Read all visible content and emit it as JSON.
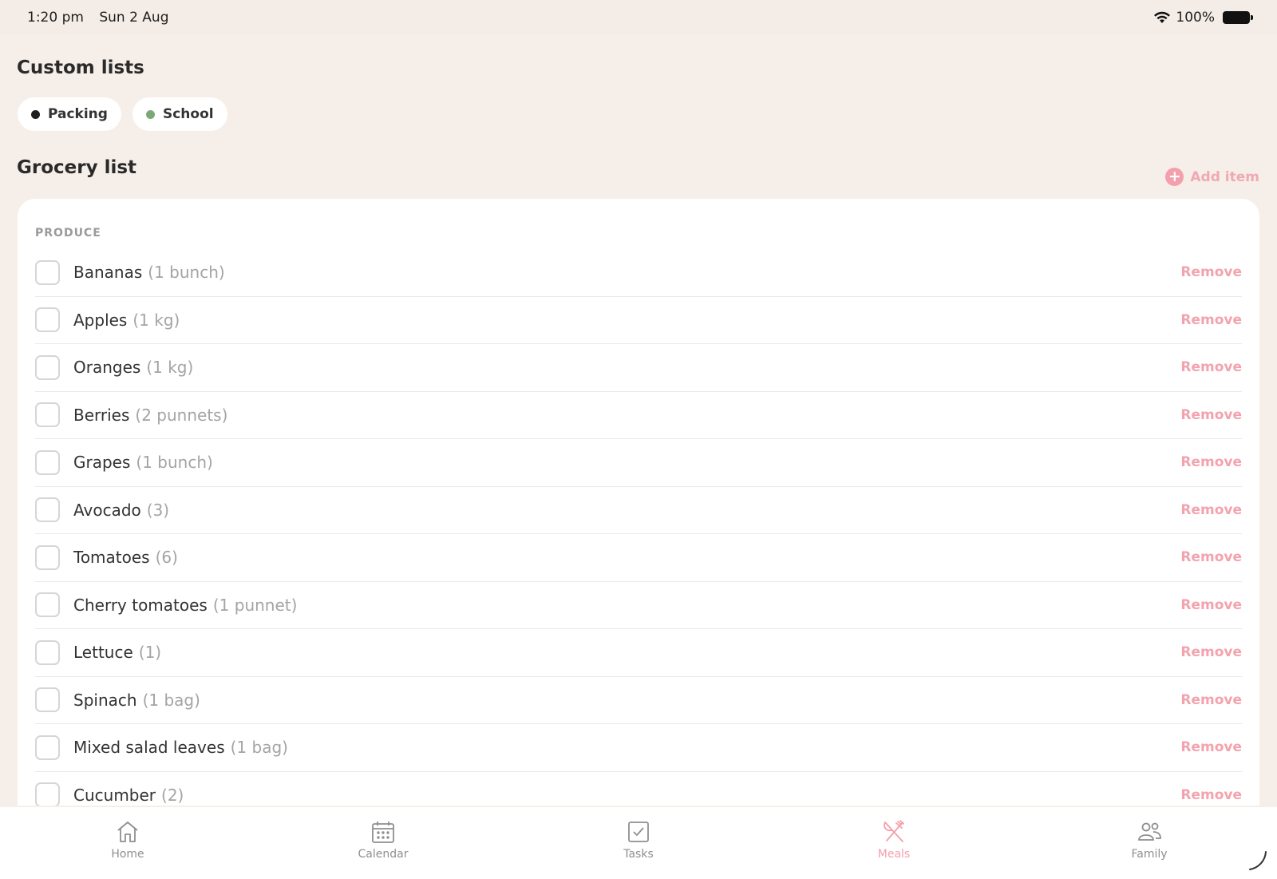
{
  "status": {
    "time": "1:20 pm",
    "date": "Sun 2 Aug",
    "battery": "100%"
  },
  "custom_lists": {
    "title": "Custom lists",
    "chips": [
      {
        "label": "Packing",
        "color": "#1f1f1f"
      },
      {
        "label": "School",
        "color": "#7aa977"
      }
    ]
  },
  "grocery": {
    "title": "Grocery list",
    "add_label": "Add item",
    "category": "PRODUCE",
    "remove_label": "Remove",
    "items": [
      {
        "name": "Bananas",
        "qty": "(1 bunch)"
      },
      {
        "name": "Apples",
        "qty": "(1 kg)"
      },
      {
        "name": "Oranges",
        "qty": "(1 kg)"
      },
      {
        "name": "Berries",
        "qty": "(2 punnets)"
      },
      {
        "name": "Grapes",
        "qty": "(1 bunch)"
      },
      {
        "name": "Avocado",
        "qty": "(3)"
      },
      {
        "name": "Tomatoes",
        "qty": "(6)"
      },
      {
        "name": "Cherry tomatoes",
        "qty": "(1 punnet)"
      },
      {
        "name": "Lettuce",
        "qty": "(1)"
      },
      {
        "name": "Spinach",
        "qty": "(1 bag)"
      },
      {
        "name": "Mixed salad leaves",
        "qty": "(1 bag)"
      },
      {
        "name": "Cucumber",
        "qty": "(2)"
      }
    ]
  },
  "tabs": [
    {
      "label": "Home",
      "icon": "home-icon",
      "active": false
    },
    {
      "label": "Calendar",
      "icon": "calendar-icon",
      "active": false
    },
    {
      "label": "Tasks",
      "icon": "tasks-icon",
      "active": false
    },
    {
      "label": "Meals",
      "icon": "meals-icon",
      "active": true
    },
    {
      "label": "Family",
      "icon": "family-icon",
      "active": false
    }
  ],
  "colors": {
    "accent": "#f3a0ac",
    "background": "#f6efe9"
  }
}
